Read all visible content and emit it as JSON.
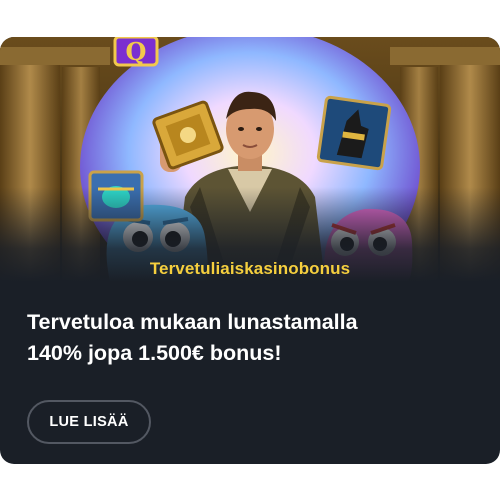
{
  "promo": {
    "category_label": "Tervetuliaiskasinobonus",
    "headline_line1": "Tervetuloa mukaan lunastamalla",
    "headline_line2": "140% jopa 1.500€ bonus!",
    "cta_label": "LUE LISÄÄ"
  },
  "colors": {
    "card_background": "#1a1f27",
    "label_yellow": "#f5cf3e",
    "button_border": "#535862",
    "text_white": "#ffffff"
  },
  "icons": [
    "q-symbol-icon",
    "book-of-ra-icon",
    "scarab-symbol-icon",
    "anubis-symbol-icon"
  ]
}
